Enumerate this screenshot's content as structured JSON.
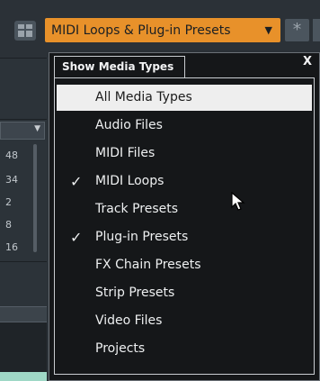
{
  "toolbar": {
    "layout_icon": "layout-grid-icon",
    "media_dropdown_label": "MIDI Loops & Plug-in Presets",
    "dropdown_arrow": "▼",
    "star_icon": "*"
  },
  "background_panel": {
    "values": [
      "48",
      "34",
      "2",
      "8",
      "16"
    ]
  },
  "popup": {
    "tab_label": "Show Media Types",
    "close_label": "X",
    "items": [
      {
        "label": "All Media Types",
        "checked": false,
        "selected": true
      },
      {
        "label": "Audio Files",
        "checked": false,
        "selected": false
      },
      {
        "label": "MIDI Files",
        "checked": false,
        "selected": false
      },
      {
        "label": "MIDI Loops",
        "checked": true,
        "selected": false
      },
      {
        "label": "Track Presets",
        "checked": false,
        "selected": false
      },
      {
        "label": "Plug-in Presets",
        "checked": true,
        "selected": false
      },
      {
        "label": "FX Chain Presets",
        "checked": false,
        "selected": false
      },
      {
        "label": "Strip Presets",
        "checked": false,
        "selected": false
      },
      {
        "label": "Video Files",
        "checked": false,
        "selected": false
      },
      {
        "label": "Projects",
        "checked": false,
        "selected": false
      }
    ],
    "check_glyph": "✓"
  },
  "colors": {
    "accent": "#e8912a",
    "popup_bg": "#151719",
    "selected_bg": "#eeeeee"
  }
}
